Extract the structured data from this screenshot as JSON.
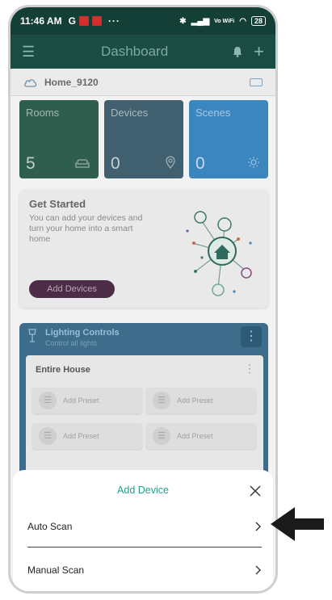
{
  "status_bar": {
    "time": "11:46 AM",
    "g_label": "G",
    "dots": "···",
    "signal_text": "Vo WiFi",
    "battery": "28"
  },
  "header": {
    "title": "Dashboard"
  },
  "home": {
    "name": "Home_9120"
  },
  "tiles": [
    {
      "label": "Rooms",
      "count": "5",
      "color": "#2f5e4f",
      "icon": "sofa-icon"
    },
    {
      "label": "Devices",
      "count": "0",
      "color": "#41606f",
      "icon": "location-icon"
    },
    {
      "label": "Scenes",
      "count": "0",
      "color": "#3c86bf",
      "icon": "sun-icon"
    }
  ],
  "get_started": {
    "title": "Get Started",
    "description": "You can add your devices and turn your home into a smart home",
    "button_label": "Add Devices"
  },
  "lighting": {
    "title": "Lighting Controls",
    "subtitle": "Control all lights",
    "panel_title": "Entire House",
    "presets": [
      "Add Preset",
      "Add Preset",
      "Add Preset",
      "Add Preset"
    ]
  },
  "sheet": {
    "title": "Add Device",
    "options": [
      "Auto Scan",
      "Manual Scan"
    ]
  },
  "colors": {
    "accent": "#22a08d",
    "header_bg": "#1b4d44",
    "status_bg": "#143f37"
  }
}
